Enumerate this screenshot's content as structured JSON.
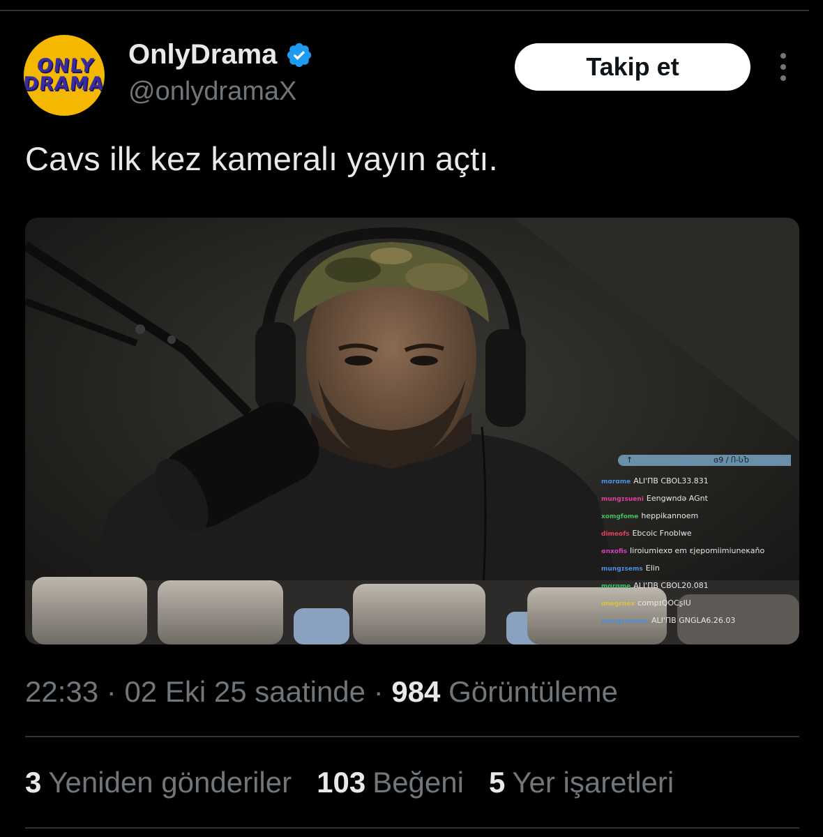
{
  "account": {
    "display_name": "OnlyDrama",
    "handle": "@onlydramaX",
    "avatar_text": [
      "ONLY",
      "DRAMA"
    ],
    "verified": true
  },
  "follow_label": "Takip et",
  "tweet_text": "Cavs ilk kez kameralı yayın açtı.",
  "media": {
    "chat_header_left": "↑",
    "chat_header_right": "ɞ9 / Ⴖ-ႱႦ",
    "chat": [
      {
        "user": "mɑrɑme",
        "msg": "ALI'ΠB CBOL33.831",
        "color": "#4a8fe0"
      },
      {
        "user": "mungɪsueni",
        "msg": "Eengwndə AGnt",
        "color": "#e040a0"
      },
      {
        "user": "xomgfome",
        "msg": "heppikannoem",
        "color": "#40c060"
      },
      {
        "user": "dimeofs",
        "msg": "Ebcoic Fnoblwe",
        "color": "#e04060"
      },
      {
        "user": "ɞnxofis",
        "msg": "Iiroiumiexʊ em ɛjepomiimiuneκaňo",
        "color": "#d040c0"
      },
      {
        "user": "mungɪsems",
        "msg": "Elin",
        "color": "#4a8fe0"
      },
      {
        "user": "mɑrɑme",
        "msg": "ALI'ΠB CBOL20.081",
        "color": "#40c060"
      },
      {
        "user": "ɑnegrnex",
        "msg": "compɪQOCʂIU",
        "color": "#e0c040"
      },
      {
        "user": "mungɪrowme",
        "msg": "ALI'ΠB GNGLA6.26.03",
        "color": "#4a8fe0"
      }
    ]
  },
  "meta": {
    "time": "22:33",
    "date": "02 Eki 25 saatinde",
    "views_count": "984",
    "views_label": "Görüntüleme"
  },
  "stats": {
    "reposts_count": "3",
    "reposts_label": "Yeniden gönderiler",
    "likes_count": "103",
    "likes_label": "Beğeni",
    "bookmarks_count": "5",
    "bookmarks_label": "Yer işaretleri"
  },
  "colors": {
    "background": "#000000",
    "verified": "#1d9bf0",
    "muted": "#71767b",
    "text": "#e7e9ea"
  }
}
